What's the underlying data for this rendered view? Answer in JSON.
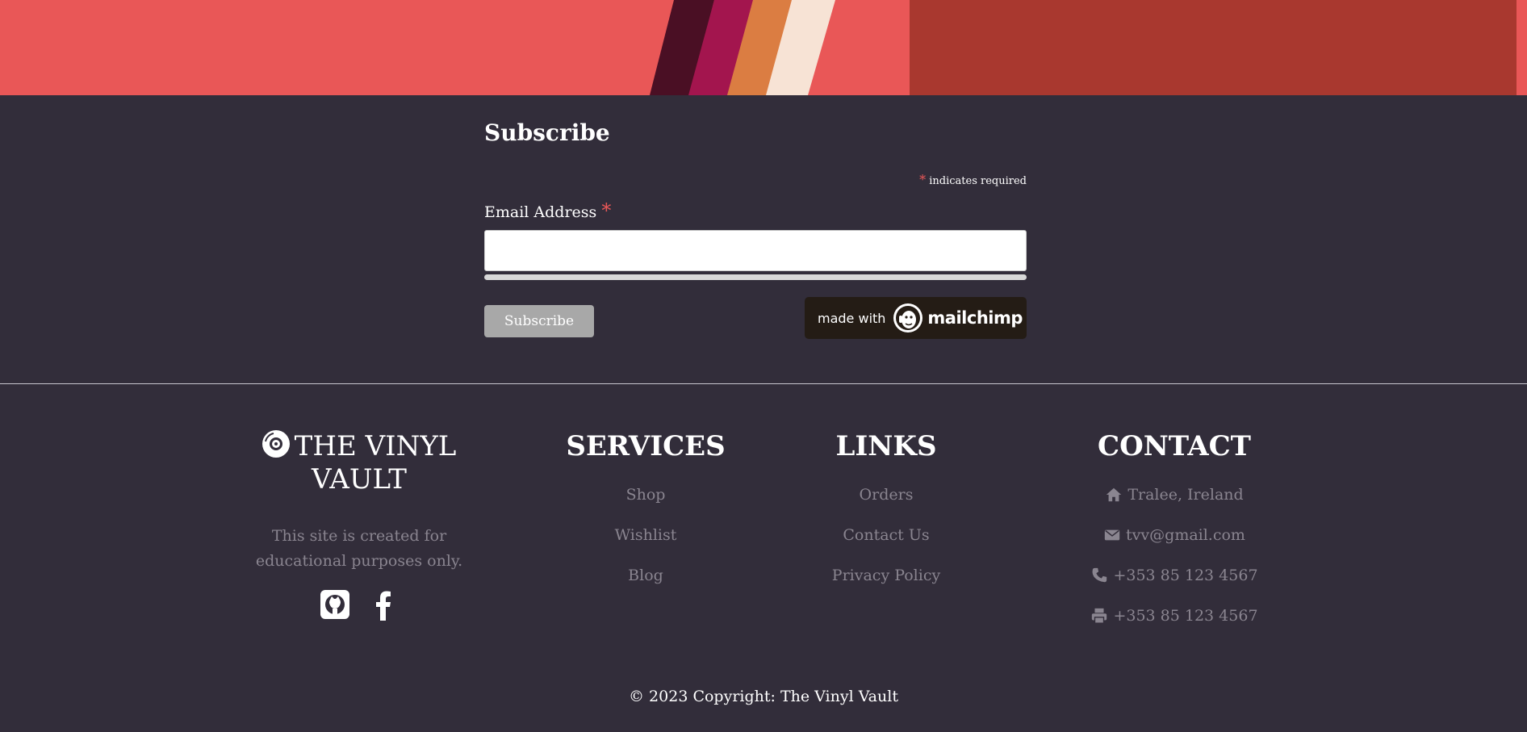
{
  "subscribe": {
    "title": "Subscribe",
    "required_star": "*",
    "required_text": "indicates required",
    "email_label": "Email Address",
    "email_star": "*",
    "email_value": "",
    "button_label": "Subscribe",
    "badge_made_with": "made with",
    "badge_brand": "mailchimp"
  },
  "footer": {
    "brand": {
      "title": "THE VINYL VAULT",
      "description": "This site is created for educational purposes only.",
      "social_icons": [
        "github-icon",
        "facebook-icon"
      ]
    },
    "services": {
      "heading": "SERVICES",
      "items": [
        "Shop",
        "Wishlist",
        "Blog"
      ]
    },
    "links": {
      "heading": "LINKS",
      "items": [
        "Orders",
        "Contact Us",
        "Privacy Policy"
      ]
    },
    "contact": {
      "heading": "CONTACT",
      "address": "Tralee, Ireland",
      "email": "tvv@gmail.com",
      "phone": "+353 85 123 4567",
      "fax": "+353 85 123 4567"
    },
    "copyright": "© 2023 Copyright: The Vinyl Vault"
  },
  "colors": {
    "background": "#322d3a",
    "banner_red": "#e95757",
    "banner_dark_red": "#a9382f",
    "stripe_1": "#4a0f24",
    "stripe_2": "#a3154e",
    "stripe_3": "#db7d42",
    "stripe_4": "#f7e3d5",
    "accent_star": "#e95757",
    "muted_text": "#8a8590"
  }
}
